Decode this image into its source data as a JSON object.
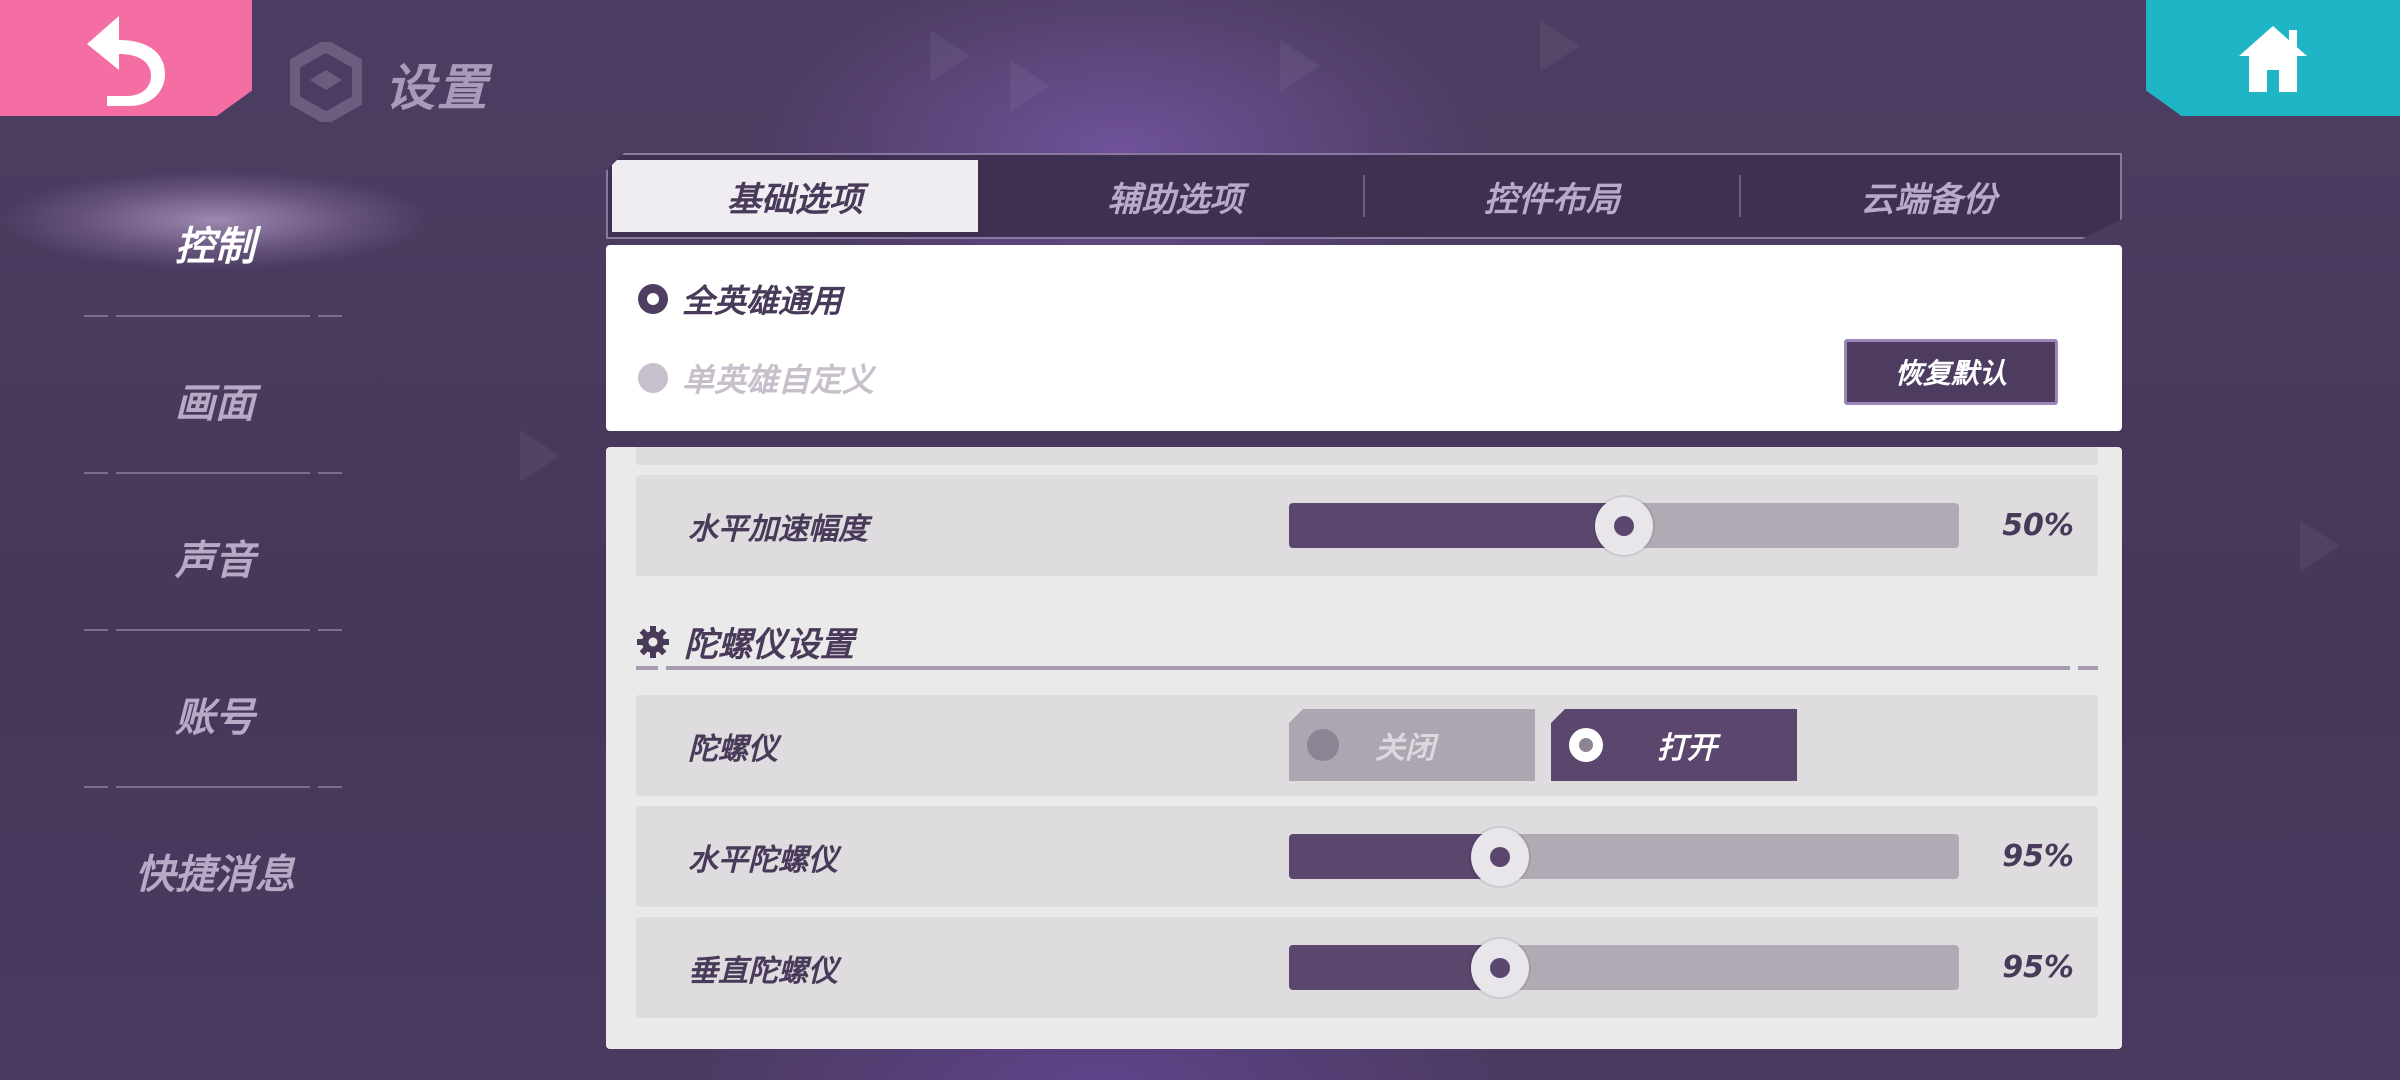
{
  "header": {
    "title": "设置",
    "back_icon": "back-arrow-icon",
    "home_icon": "home-icon",
    "logo_icon": "game-logo-icon"
  },
  "sidebar": {
    "items": [
      {
        "label": "控制",
        "active": true
      },
      {
        "label": "画面",
        "active": false
      },
      {
        "label": "声音",
        "active": false
      },
      {
        "label": "账号",
        "active": false
      },
      {
        "label": "快捷消息",
        "active": false
      }
    ]
  },
  "tabs": [
    {
      "label": "基础选项",
      "active": true
    },
    {
      "label": "辅助选项",
      "active": false
    },
    {
      "label": "控件布局",
      "active": false
    },
    {
      "label": "云端备份",
      "active": false
    }
  ],
  "mode": {
    "option_all": "全英雄通用",
    "option_single": "单英雄自定义",
    "selected": "全英雄通用",
    "reset_label": "恢复默认"
  },
  "settings": {
    "horizontal_accel": {
      "label": "水平加速幅度",
      "value_text": "50%",
      "level": 0.5
    },
    "gyro_section_title": "陀螺仪设置",
    "gyro_toggle": {
      "label": "陀螺仪",
      "off_label": "关闭",
      "on_label": "打开",
      "state": "on"
    },
    "horizontal_gyro": {
      "label": "水平陀螺仪",
      "value_text": "95%",
      "level": 0.315
    },
    "vertical_gyro": {
      "label": "垂直陀螺仪",
      "value_text": "95%",
      "level": 0.315
    }
  },
  "colors": {
    "back_button": "#f46ea4",
    "home_button": "#1eb5c6",
    "background": "#4a3a5e",
    "accent": "#5b476e"
  }
}
